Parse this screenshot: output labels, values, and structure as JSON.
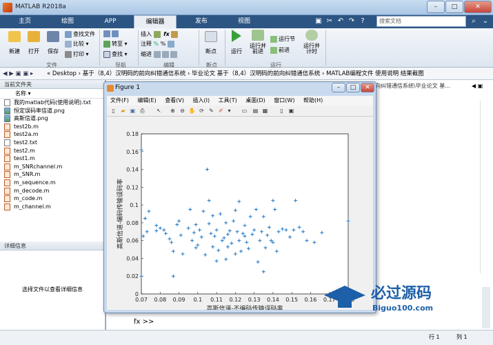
{
  "window": {
    "title": "MATLAB R2018a",
    "min": "–",
    "max": "□",
    "close": "✕"
  },
  "tabs": [
    {
      "label": "主页",
      "active": false
    },
    {
      "label": "绘图",
      "active": false
    },
    {
      "label": "APP",
      "active": false
    },
    {
      "label": "编辑器",
      "active": true
    },
    {
      "label": "发布",
      "active": false
    },
    {
      "label": "视图",
      "active": false
    }
  ],
  "search_placeholder": "搜索文档",
  "ribbon": {
    "new": "新建",
    "open": "打开",
    "save": "保存",
    "find_files": "查找文件",
    "compare": "比较",
    "print": "打印",
    "insert": "插入",
    "fx": "fx",
    "comment": "注释",
    "indent": "缩进",
    "goto": "转至",
    "find": "查找",
    "breakpoint": "断点",
    "run": "运行",
    "run_advance": "运行并\n前进",
    "run_section": "运行节",
    "advance": "前进",
    "run_time": "运行并\n计时",
    "groups": {
      "file": "文件",
      "nav": "导航",
      "edit": "编辑",
      "breakpoints": "断点",
      "run": "运行"
    }
  },
  "address": {
    "path": "« Desktop › 基于（8,4）汉明码的前向纠错通信系统 › 毕业论文 基于（8,4）汉明码的前向纠错通信系统 › MATLAB编程文件 使用说明 结果截图"
  },
  "left_panel": {
    "header": "当前文件夹",
    "col_name": "名称",
    "files": [
      {
        "name": "我的matlab代码(使用说明).txt",
        "type": "txt"
      },
      {
        "name": "恒定误码率信道.png",
        "type": "img"
      },
      {
        "name": "高斯信道.png",
        "type": "img"
      },
      {
        "name": "test2b.m",
        "type": "m"
      },
      {
        "name": "test2a.m",
        "type": "m"
      },
      {
        "name": "test2.txt",
        "type": "txt"
      },
      {
        "name": "test2.m",
        "type": "m"
      },
      {
        "name": "test1.m",
        "type": "m"
      },
      {
        "name": "m_SNRchannel.m",
        "type": "m"
      },
      {
        "name": "m_SNR.m",
        "type": "m"
      },
      {
        "name": "m_sequence.m",
        "type": "m"
      },
      {
        "name": "m_decode.m",
        "type": "m"
      },
      {
        "name": "m_code.m",
        "type": "m"
      },
      {
        "name": "m_channel.m",
        "type": "m"
      }
    ],
    "detail_header": "详细信息",
    "detail_text": "选择文件以查看详细信息"
  },
  "editor": {
    "tab_text": "向纠错通信系统\\毕业论文 基...",
    "cmd_prompt": "fx >>"
  },
  "status": {
    "row": "行 1",
    "col": "列 1"
  },
  "figure": {
    "title": "Figure 1",
    "menu": [
      "文件(F)",
      "编辑(E)",
      "查看(V)",
      "插入(I)",
      "工具(T)",
      "桌面(D)",
      "窗口(W)",
      "帮助(H)"
    ]
  },
  "watermark": {
    "text": "必过源码",
    "url": "Biguo100.com"
  },
  "chart_data": {
    "type": "scatter",
    "marker": "+",
    "color": "#1f77c4",
    "xlabel": "高斯信道-不编码传输误码率",
    "ylabel": "高斯信道-编码传输误码率",
    "xlim": [
      0.07,
      0.18
    ],
    "ylim": [
      0,
      0.18
    ],
    "xticks": [
      "0.07",
      "0.08",
      "0.09",
      "0.1",
      "0.11",
      "0.12",
      "0.13",
      "0.14",
      "0.15",
      "0.16",
      "0.17",
      "0.18"
    ],
    "yticks": [
      "0",
      "0.02",
      "0.04",
      "0.06",
      "0.08",
      "0.1",
      "0.12",
      "0.14",
      "0.16",
      "0.18"
    ],
    "points": [
      [
        0.07,
        0.162
      ],
      [
        0.07,
        0.02
      ],
      [
        0.071,
        0.065
      ],
      [
        0.072,
        0.085
      ],
      [
        0.074,
        0.093
      ],
      [
        0.073,
        0.07
      ],
      [
        0.078,
        0.071
      ],
      [
        0.078,
        0.077
      ],
      [
        0.08,
        0.074
      ],
      [
        0.082,
        0.072
      ],
      [
        0.083,
        0.068
      ],
      [
        0.085,
        0.062
      ],
      [
        0.086,
        0.058
      ],
      [
        0.087,
        0.02
      ],
      [
        0.087,
        0.048
      ],
      [
        0.089,
        0.078
      ],
      [
        0.09,
        0.082
      ],
      [
        0.091,
        0.066
      ],
      [
        0.092,
        0.045
      ],
      [
        0.095,
        0.074
      ],
      [
        0.096,
        0.095
      ],
      [
        0.097,
        0.06
      ],
      [
        0.098,
        0.069
      ],
      [
        0.099,
        0.052
      ],
      [
        0.1,
        0.055
      ],
      [
        0.101,
        0.072
      ],
      [
        0.102,
        0.064
      ],
      [
        0.103,
        0.093
      ],
      [
        0.104,
        0.044
      ],
      [
        0.105,
        0.14
      ],
      [
        0.106,
        0.105
      ],
      [
        0.106,
        0.079
      ],
      [
        0.107,
        0.068
      ],
      [
        0.108,
        0.053
      ],
      [
        0.109,
        0.065
      ],
      [
        0.11,
        0.072
      ],
      [
        0.11,
        0.037
      ],
      [
        0.111,
        0.049
      ],
      [
        0.112,
        0.09
      ],
      [
        0.113,
        0.06
      ],
      [
        0.114,
        0.063
      ],
      [
        0.115,
        0.08
      ],
      [
        0.115,
        0.039
      ],
      [
        0.116,
        0.053
      ],
      [
        0.117,
        0.071
      ],
      [
        0.118,
        0.057
      ],
      [
        0.119,
        0.082
      ],
      [
        0.12,
        0.094
      ],
      [
        0.12,
        0.045
      ],
      [
        0.121,
        0.07
      ],
      [
        0.122,
        0.104
      ],
      [
        0.122,
        0.06
      ],
      [
        0.123,
        0.048
      ],
      [
        0.124,
        0.068
      ],
      [
        0.125,
        0.077
      ],
      [
        0.126,
        0.058
      ],
      [
        0.127,
        0.051
      ],
      [
        0.128,
        0.087
      ],
      [
        0.129,
        0.067
      ],
      [
        0.13,
        0.072
      ],
      [
        0.131,
        0.095
      ],
      [
        0.132,
        0.036
      ],
      [
        0.133,
        0.06
      ],
      [
        0.134,
        0.07
      ],
      [
        0.135,
        0.087
      ],
      [
        0.136,
        0.052
      ],
      [
        0.137,
        0.066
      ],
      [
        0.138,
        0.075
      ],
      [
        0.139,
        0.06
      ],
      [
        0.14,
        0.105
      ],
      [
        0.141,
        0.095
      ],
      [
        0.142,
        0.048
      ],
      [
        0.143,
        0.07
      ],
      [
        0.145,
        0.073
      ],
      [
        0.147,
        0.072
      ],
      [
        0.149,
        0.064
      ],
      [
        0.151,
        0.072
      ],
      [
        0.152,
        0.105
      ],
      [
        0.154,
        0.075
      ],
      [
        0.156,
        0.07
      ],
      [
        0.158,
        0.06
      ],
      [
        0.162,
        0.058
      ],
      [
        0.166,
        0.069
      ],
      [
        0.18,
        0.082
      ],
      [
        0.135,
        0.025
      ],
      [
        0.14,
        0.058
      ],
      [
        0.125,
        0.065
      ],
      [
        0.108,
        0.088
      ],
      [
        0.099,
        0.078
      ],
      [
        0.116,
        0.067
      ]
    ]
  }
}
